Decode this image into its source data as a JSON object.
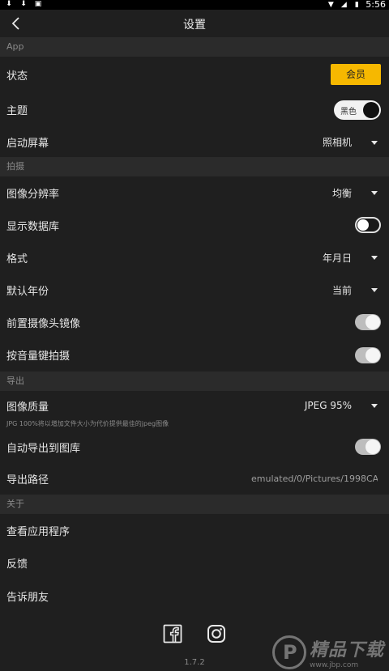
{
  "status_bar": {
    "time": "5:56"
  },
  "header": {
    "title": "设置"
  },
  "sections": {
    "app": "App",
    "shoot": "拍摄",
    "export": "导出",
    "about": "关于"
  },
  "app": {
    "status_label": "状态",
    "member_button": "会员",
    "theme_label": "主题",
    "theme_value": "黑色",
    "launch_label": "启动屏幕",
    "launch_value": "照相机"
  },
  "shoot": {
    "resolution_label": "图像分辨率",
    "resolution_value": "均衡",
    "show_db_label": "显示数据库",
    "show_db_on": false,
    "format_label": "格式",
    "format_value": "年月日",
    "default_year_label": "默认年份",
    "default_year_value": "当前",
    "front_mirror_label": "前置摄像头镜像",
    "front_mirror_on": true,
    "volume_shutter_label": "按音量键拍摄",
    "volume_shutter_on": true
  },
  "export": {
    "quality_label": "图像质量",
    "quality_value": "JPEG 95%",
    "quality_note": "JPG 100%将以增加文件大小为代价提供最佳的jpeg图像",
    "auto_export_label": "自动导出到图库",
    "auto_export_on": true,
    "path_label": "导出路径",
    "path_value": "emulated/0/Pictures/1998CAM"
  },
  "about": {
    "view_apps": "查看应用程序",
    "feedback": "反馈",
    "tell_friends": "告诉朋友"
  },
  "footer": {
    "version": "1.7.2",
    "icons": [
      "facebook-icon",
      "instagram-icon"
    ]
  },
  "watermark": {
    "text": "精品下载",
    "url": "www.jbp.com"
  },
  "colors": {
    "accent": "#f6b800",
    "background": "#1f1f1f",
    "section": "#2b2b2b"
  }
}
